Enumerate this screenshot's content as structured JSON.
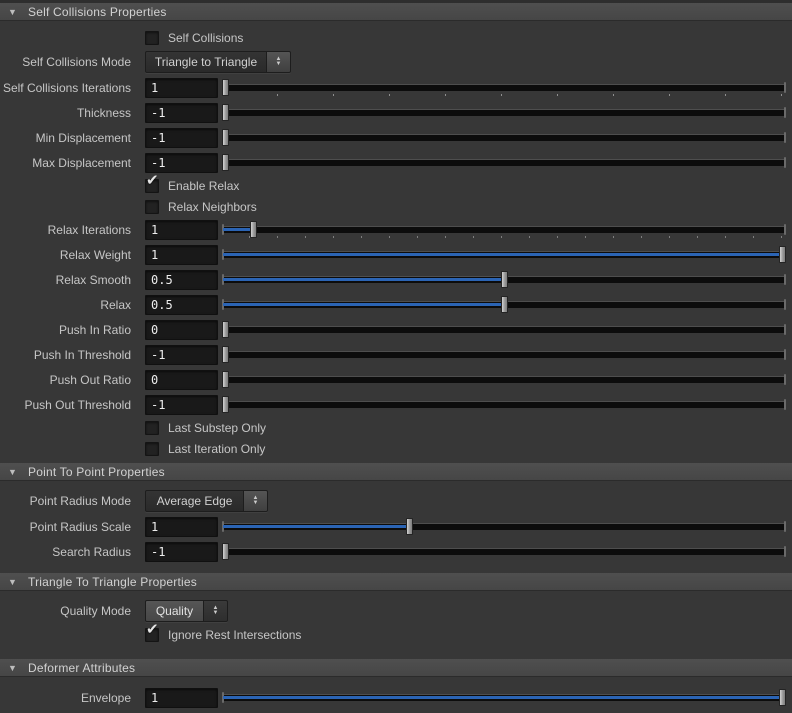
{
  "icons": {
    "check": "✔",
    "collapse": "▼",
    "spinner_up": "▲",
    "spinner_down": "▼"
  },
  "colors": {
    "panel_bg": "#373737",
    "header_bg": "#4a4a4a",
    "accent_blue": "#2b64b4",
    "field_bg": "#191919"
  },
  "sections": {
    "self_collisions_properties": {
      "title": "Self Collisions Properties",
      "rows": {
        "self_collisions": {
          "label": "Self Collisions",
          "checked": false
        },
        "self_collisions_mode": {
          "label": "Self Collisions Mode",
          "value": "Triangle to Triangle"
        },
        "self_collisions_iterations": {
          "label": "Self Collisions Iterations",
          "value": "1",
          "slider_pct": 0
        },
        "thickness": {
          "label": "Thickness",
          "value": "-1",
          "slider_pct": 0
        },
        "min_displacement": {
          "label": "Min Displacement",
          "value": "-1",
          "slider_pct": 0
        },
        "max_displacement": {
          "label": "Max Displacement",
          "value": "-1",
          "slider_pct": 0
        },
        "enable_relax": {
          "label": "Enable Relax",
          "checked": true
        },
        "relax_neighbors": {
          "label": "Relax Neighbors",
          "checked": false
        },
        "relax_iterations": {
          "label": "Relax Iterations",
          "value": "1",
          "slider_pct": 5
        },
        "relax_weight": {
          "label": "Relax Weight",
          "value": "1",
          "slider_pct": 100
        },
        "relax_smooth": {
          "label": "Relax Smooth",
          "value": "0.5",
          "slider_pct": 50
        },
        "relax": {
          "label": "Relax",
          "value": "0.5",
          "slider_pct": 50
        },
        "push_in_ratio": {
          "label": "Push In Ratio",
          "value": "0",
          "slider_pct": 0
        },
        "push_in_threshold": {
          "label": "Push In Threshold",
          "value": "-1",
          "slider_pct": 0
        },
        "push_out_ratio": {
          "label": "Push Out Ratio",
          "value": "0",
          "slider_pct": 0
        },
        "push_out_threshold": {
          "label": "Push Out Threshold",
          "value": "-1",
          "slider_pct": 0
        },
        "last_substep_only": {
          "label": "Last Substep Only",
          "checked": false
        },
        "last_iteration_only": {
          "label": "Last Iteration Only",
          "checked": false
        }
      }
    },
    "point_to_point_properties": {
      "title": "Point To Point Properties",
      "rows": {
        "point_radius_mode": {
          "label": "Point Radius Mode",
          "value": "Average Edge"
        },
        "point_radius_scale": {
          "label": "Point Radius Scale",
          "value": "1",
          "slider_pct": 33
        },
        "search_radius": {
          "label": "Search Radius",
          "value": "-1",
          "slider_pct": 0
        }
      }
    },
    "triangle_to_triangle_properties": {
      "title": "Triangle To Triangle Properties",
      "rows": {
        "quality_mode": {
          "label": "Quality Mode",
          "value": "Quality"
        },
        "ignore_rest_intersections": {
          "label": "Ignore Rest Intersections",
          "checked": true
        }
      }
    },
    "deformer_attributes": {
      "title": "Deformer Attributes",
      "rows": {
        "envelope": {
          "label": "Envelope",
          "value": "1",
          "slider_pct": 100
        }
      }
    }
  }
}
